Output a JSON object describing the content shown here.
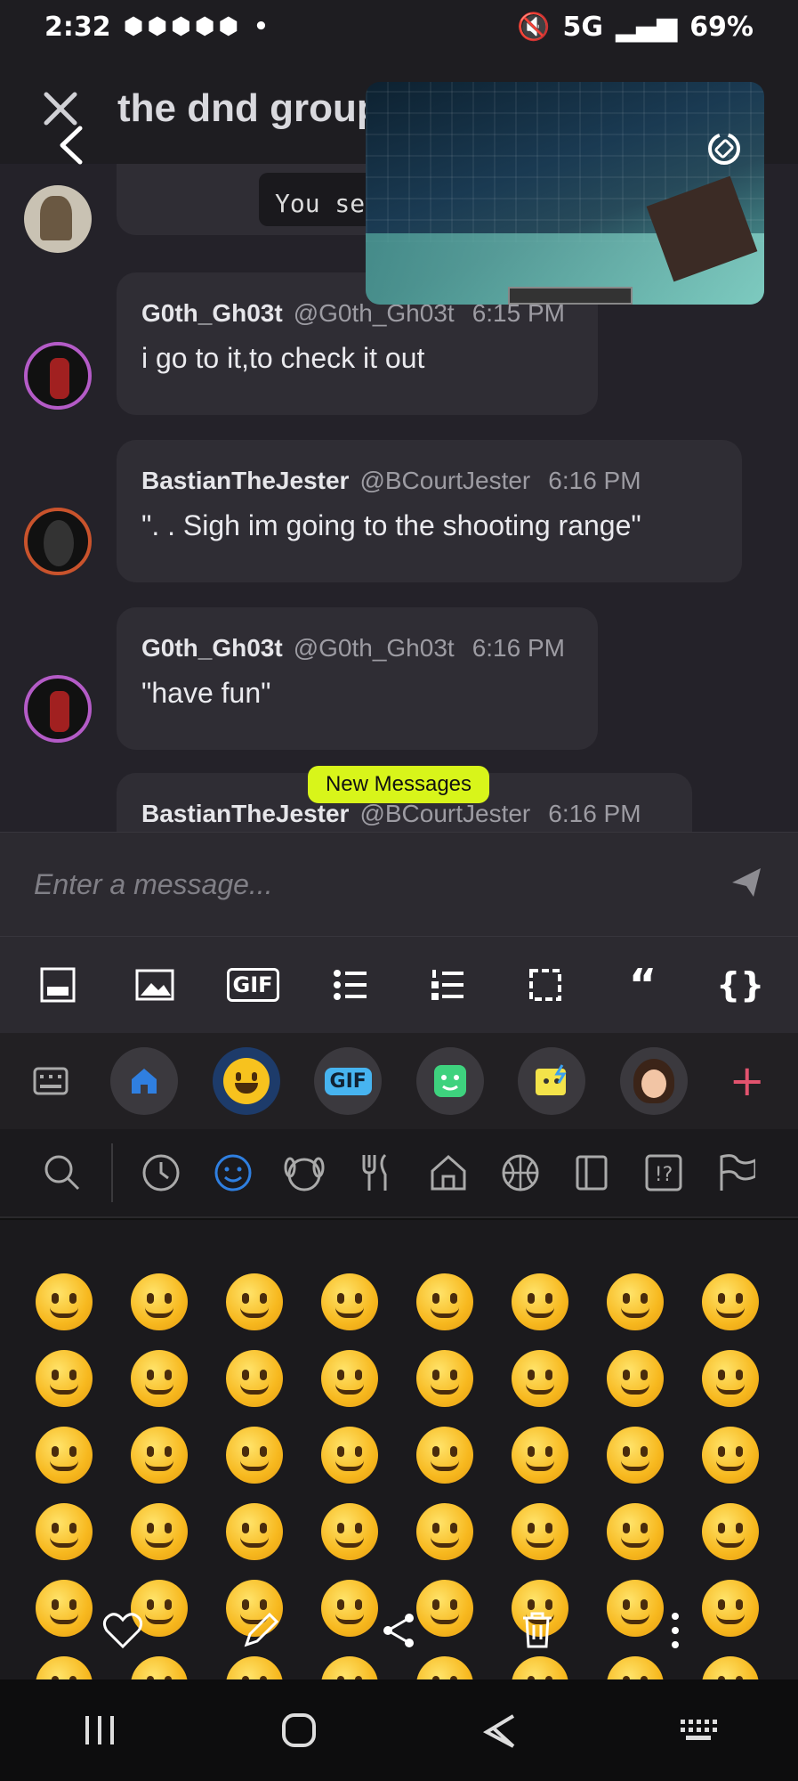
{
  "status_bar": {
    "time": "2:32",
    "notif_glyphs": "⬢⬢⬢⬢⬢ •",
    "network": "5G",
    "battery": "69%"
  },
  "header": {
    "title": "the dnd group"
  },
  "chat": {
    "partial_message": {
      "code_text": "You see a new"
    },
    "messages": [
      {
        "user": "G0th_Gh03t",
        "handle": "@G0th_Gh03t",
        "time": "6:15 PM",
        "text": "i go to it,to check it out"
      },
      {
        "user": "BastianTheJester",
        "handle": "@BCourtJester",
        "time": "6:16 PM",
        "text": "\". . Sigh im going to the shooting range\""
      },
      {
        "user": "G0th_Gh03t",
        "handle": "@G0th_Gh03t",
        "time": "6:16 PM",
        "text": "\"have fun\""
      },
      {
        "user": "BastianTheJester",
        "handle": "@BCourtJester",
        "time": "6:16 PM",
        "text": ""
      }
    ],
    "new_messages_label": "New Messages"
  },
  "input": {
    "placeholder": "Enter a message..."
  },
  "format_toolbar": {
    "gif_label": "GIF",
    "quote_label": "“",
    "code_label": "{}"
  },
  "keyboard_toolbar": {
    "gif_label": "GIF",
    "plus_label": "+"
  },
  "colors": {
    "accent": "#e2536e",
    "new_badge": "#d8f51a",
    "selected_blue": "#2f7fe0"
  }
}
